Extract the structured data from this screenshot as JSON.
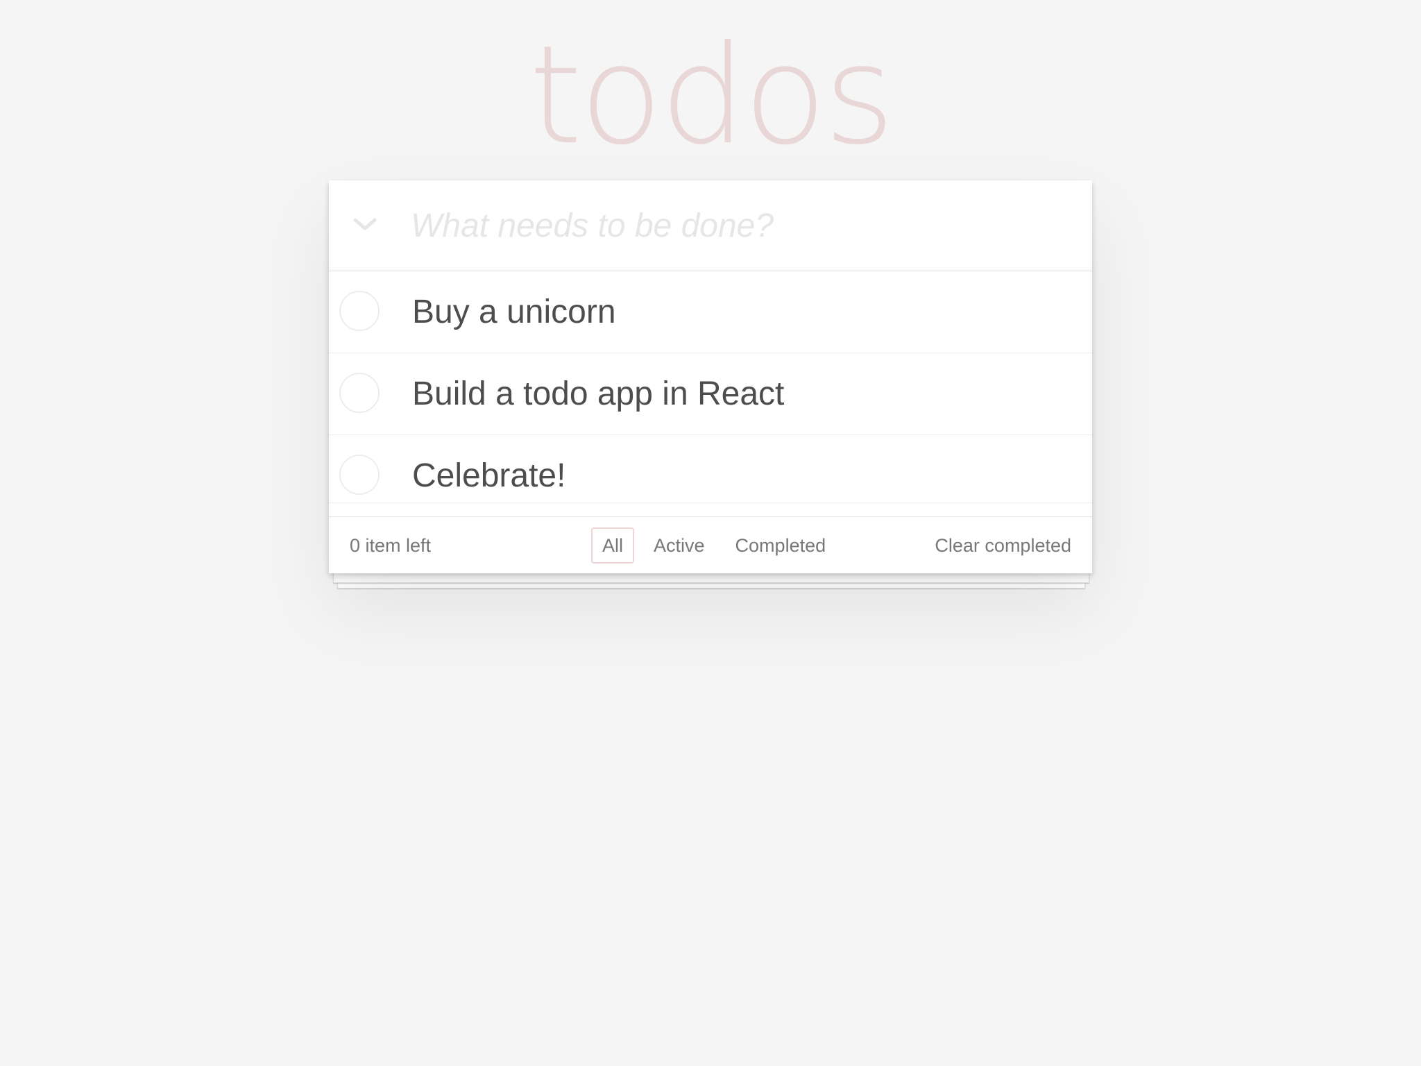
{
  "header": {
    "title": "todos",
    "new_todo_placeholder": "What needs to be done?",
    "toggle_all_icon": "chevron-down-icon"
  },
  "todos": [
    {
      "label": "Buy a unicorn",
      "completed": false
    },
    {
      "label": "Build a todo app in React",
      "completed": false
    },
    {
      "label": "Celebrate!",
      "completed": false
    }
  ],
  "footer": {
    "count_text": "0 item left",
    "filters": [
      {
        "label": "All",
        "selected": true
      },
      {
        "label": "Active",
        "selected": false
      },
      {
        "label": "Completed",
        "selected": false
      }
    ],
    "clear_completed_label": "Clear completed"
  },
  "colors": {
    "background": "#f5f5f5",
    "title": "#e9d6d6",
    "text": "#4d4d4d",
    "muted": "#777777",
    "selected_filter_border": "#efd5d5"
  }
}
